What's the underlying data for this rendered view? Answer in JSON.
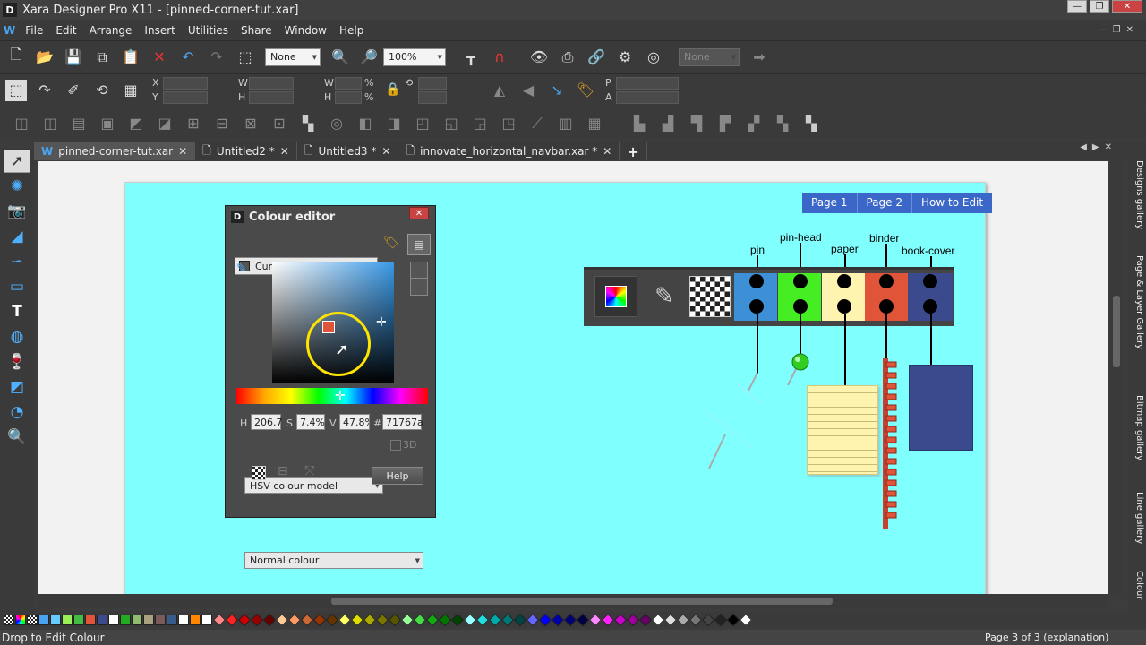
{
  "window": {
    "title": "Xara Designer Pro X11 - [pinned-corner-tut.xar]",
    "logo": "D"
  },
  "menu": [
    "File",
    "Edit",
    "Arrange",
    "Insert",
    "Utilities",
    "Share",
    "Window",
    "Help"
  ],
  "toolbar": {
    "quality_combo": "None",
    "zoom_combo": "100%",
    "disabled_combo": "None"
  },
  "infobar": {
    "x_label": "X",
    "y_label": "Y",
    "w_label": "W",
    "h_label": "H",
    "w2_label": "W",
    "h2_label": "H",
    "pct1": "%",
    "pct2": "%",
    "p_label": "P",
    "a_label": "A"
  },
  "tabs": [
    {
      "label": "pinned-corner-tut.xar",
      "active": true
    },
    {
      "label": "Untitled2 *",
      "active": false
    },
    {
      "label": "Untitled3 *",
      "active": false
    },
    {
      "label": "innovate_horizontal_navbar.xar *",
      "active": false
    }
  ],
  "page_nav": [
    "Page 1",
    "Page 2",
    "How to Edit"
  ],
  "labels": {
    "pin": "pin",
    "pin_head": "pin-head",
    "paper": "paper",
    "binder": "binder",
    "book_cover": "book-cover"
  },
  "strip_colors": {
    "pin": "#3d8fd6",
    "pin_head": "#44ee22",
    "paper": "#fff3b0",
    "binder": "#e0553a",
    "book_cover": "#3b4a8c"
  },
  "colour_editor": {
    "title": "Colour editor",
    "fill_combo": "Current fill colour",
    "h_label": "H",
    "h_value": "206.7",
    "s_label": "S",
    "s_value": "7.4%",
    "v_label": "V",
    "v_value": "47.8%",
    "hash_label": "#",
    "hex_value": "71767a",
    "model_combo": "HSV colour model",
    "three_d": "3D",
    "help": "Help",
    "normal_combo": "Normal colour",
    "current_colour": "#e0553a"
  },
  "gallery_tabs": [
    "Designs gallery",
    "Page & Layer Gallery",
    "Bitmap gallery",
    "Line gallery",
    "Colour"
  ],
  "status": {
    "left": "Drop to Edit Colour",
    "right": "Page 3 of 3 (explanation)"
  },
  "palette_colors": [
    "#4aa3f0",
    "#66ccff",
    "#99ee55",
    "#44bb44",
    "#e0553a",
    "#3b4a8c",
    "#ffffff",
    "#22aa22",
    "#8fbc6e",
    "#a8a080",
    "#7a5a5a",
    "#3a5a8a",
    "#ffffff",
    "#ff8800",
    "#ffffff"
  ],
  "palette_diamonds": [
    "#ff8888",
    "#ff2222",
    "#cc0000",
    "#990000",
    "#660000",
    "#ffcc99",
    "#ff9966",
    "#cc6633",
    "#993300",
    "#663300",
    "#ffff66",
    "#dddd00",
    "#aaaa00",
    "#777700",
    "#555500",
    "#99ff99",
    "#44dd44",
    "#11aa11",
    "#007700",
    "#004400",
    "#99ffff",
    "#22dddd",
    "#00aaaa",
    "#007777",
    "#004444",
    "#6666ff",
    "#0000ff",
    "#0000aa",
    "#000077",
    "#000044",
    "#ff88ff",
    "#ff22ff",
    "#cc00cc",
    "#990099",
    "#660066",
    "#ffffff",
    "#dddddd",
    "#aaaaaa",
    "#777777",
    "#444444",
    "#222222",
    "#000000",
    "#ffffff"
  ]
}
